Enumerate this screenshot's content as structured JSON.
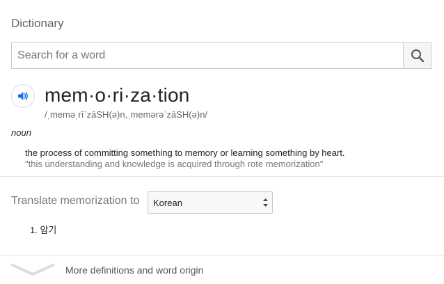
{
  "panel": {
    "title": "Dictionary"
  },
  "search": {
    "placeholder": "Search for a word",
    "value": "",
    "icon": "search-icon"
  },
  "entry": {
    "speaker_icon": "speaker-icon",
    "word": "mem·o·ri·za·tion",
    "phonetic": "/ˌmeməˌrīˈzāSH(ə)n,ˌmemərəˈzāSH(ə)n/",
    "part_of_speech": "noun",
    "definition": "the process of committing something to memory or learning something by heart.",
    "example": "\"this understanding and knowledge is acquired through rote memorization\""
  },
  "translate": {
    "label": "Translate memorization to",
    "selected_language": "Korean",
    "results": [
      {
        "number": "1.",
        "text": "암기"
      }
    ]
  },
  "more": {
    "label": "More definitions and word origin",
    "icon": "chevron-down-icon"
  },
  "colors": {
    "speaker_blue": "#1a73e8",
    "muted_text": "#777777",
    "border": "#c9c9c9"
  }
}
